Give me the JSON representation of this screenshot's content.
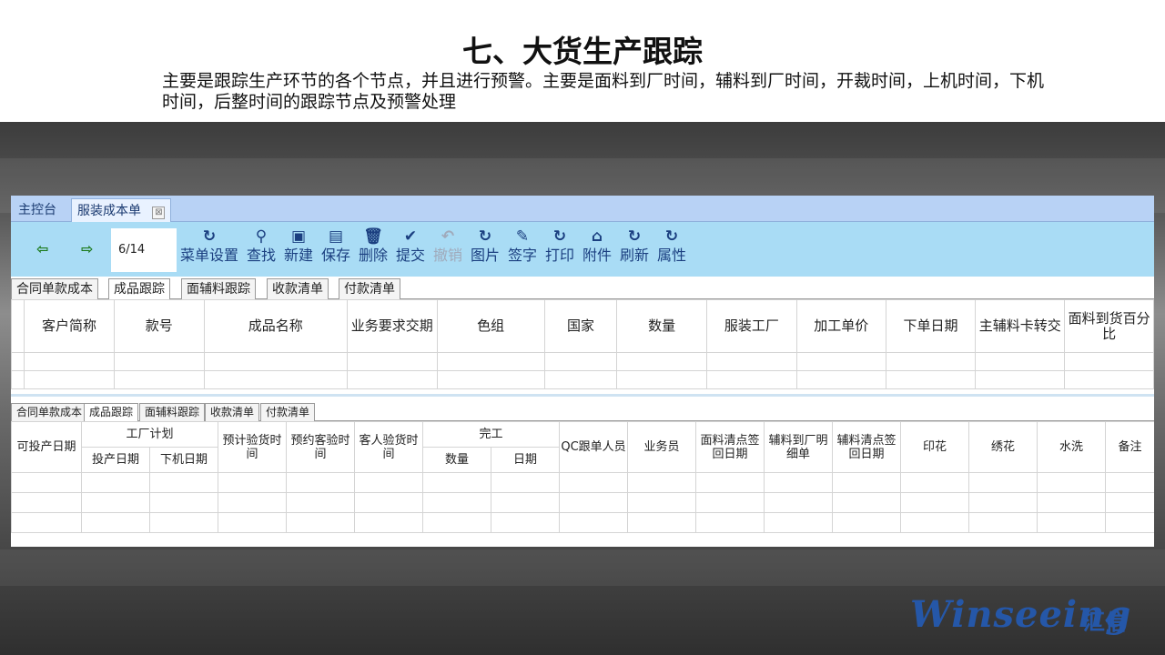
{
  "slide": {
    "title": "七、大货生产跟踪",
    "subtitle": "主要是跟踪生产环节的各个节点，并且进行预警。主要是面料到厂时间，辅料到厂时间，开裁时间，上机时间，下机时间，后整时间的跟踪节点及预警处理"
  },
  "window_tabs": [
    {
      "label": "主控台"
    },
    {
      "label": "服装成本单"
    }
  ],
  "window_tab_close": "⊠",
  "toolbar": {
    "prev_icon": "⇦",
    "next_icon": "⇨",
    "pager": "6/14",
    "buttons": [
      {
        "label": "菜单设置",
        "icon": "↻"
      },
      {
        "label": "查找",
        "icon": "⚲"
      },
      {
        "label": "新建",
        "icon": "▣"
      },
      {
        "label": "保存",
        "icon": "▤"
      },
      {
        "label": "删除",
        "icon": "🗑"
      },
      {
        "label": "提交",
        "icon": "✔"
      },
      {
        "label": "撤销",
        "icon": "↶"
      },
      {
        "label": "图片",
        "icon": "↻"
      },
      {
        "label": "签字",
        "icon": "✎"
      },
      {
        "label": "打印",
        "icon": "↻"
      },
      {
        "label": "附件",
        "icon": "⌂"
      },
      {
        "label": "刷新",
        "icon": "↻"
      },
      {
        "label": "属性",
        "icon": "↻"
      }
    ]
  },
  "sub_tabs": [
    "合同单款成本",
    "成品跟踪",
    "面辅料跟踪",
    "收款清单",
    "付款清单"
  ],
  "grid1": {
    "columns": [
      "客户简称",
      "款号",
      "成品名称",
      "业务要求交期",
      "色组",
      "国家",
      "数量",
      "服装工厂",
      "加工单价",
      "下单日期",
      "主辅料卡转交",
      "面料到货百分比"
    ]
  },
  "grid2": {
    "col_first": "可投产日期",
    "group_factory": "工厂计划",
    "factory_sub": [
      "投产日期",
      "下机日期"
    ],
    "col_inspect_est": "预计验货时间",
    "col_inspect_book": "预约客验时间",
    "col_inspect_client": "客人验货时间",
    "group_done": "完工",
    "done_sub": [
      "数量",
      "日期"
    ],
    "col_qc": "QC跟单人员",
    "col_sales": "业务员",
    "col_fabric_sign": "面料清点签回日期",
    "col_acc_detail": "辅料到厂明细单",
    "col_acc_sign": "辅料清点签回日期",
    "col_print": "印花",
    "col_embroidery": "绣花",
    "col_wash": "水洗",
    "col_note": "备注"
  },
  "brand": {
    "logo_text": "Winseeing",
    "logo_cn": "汇信"
  },
  "colors": {
    "toolbar_bg": "#a9dcf5",
    "tabbar_bg": "#b8d2f5",
    "icon_blue": "#1b3f80",
    "brand_blue": "#2557a8"
  }
}
